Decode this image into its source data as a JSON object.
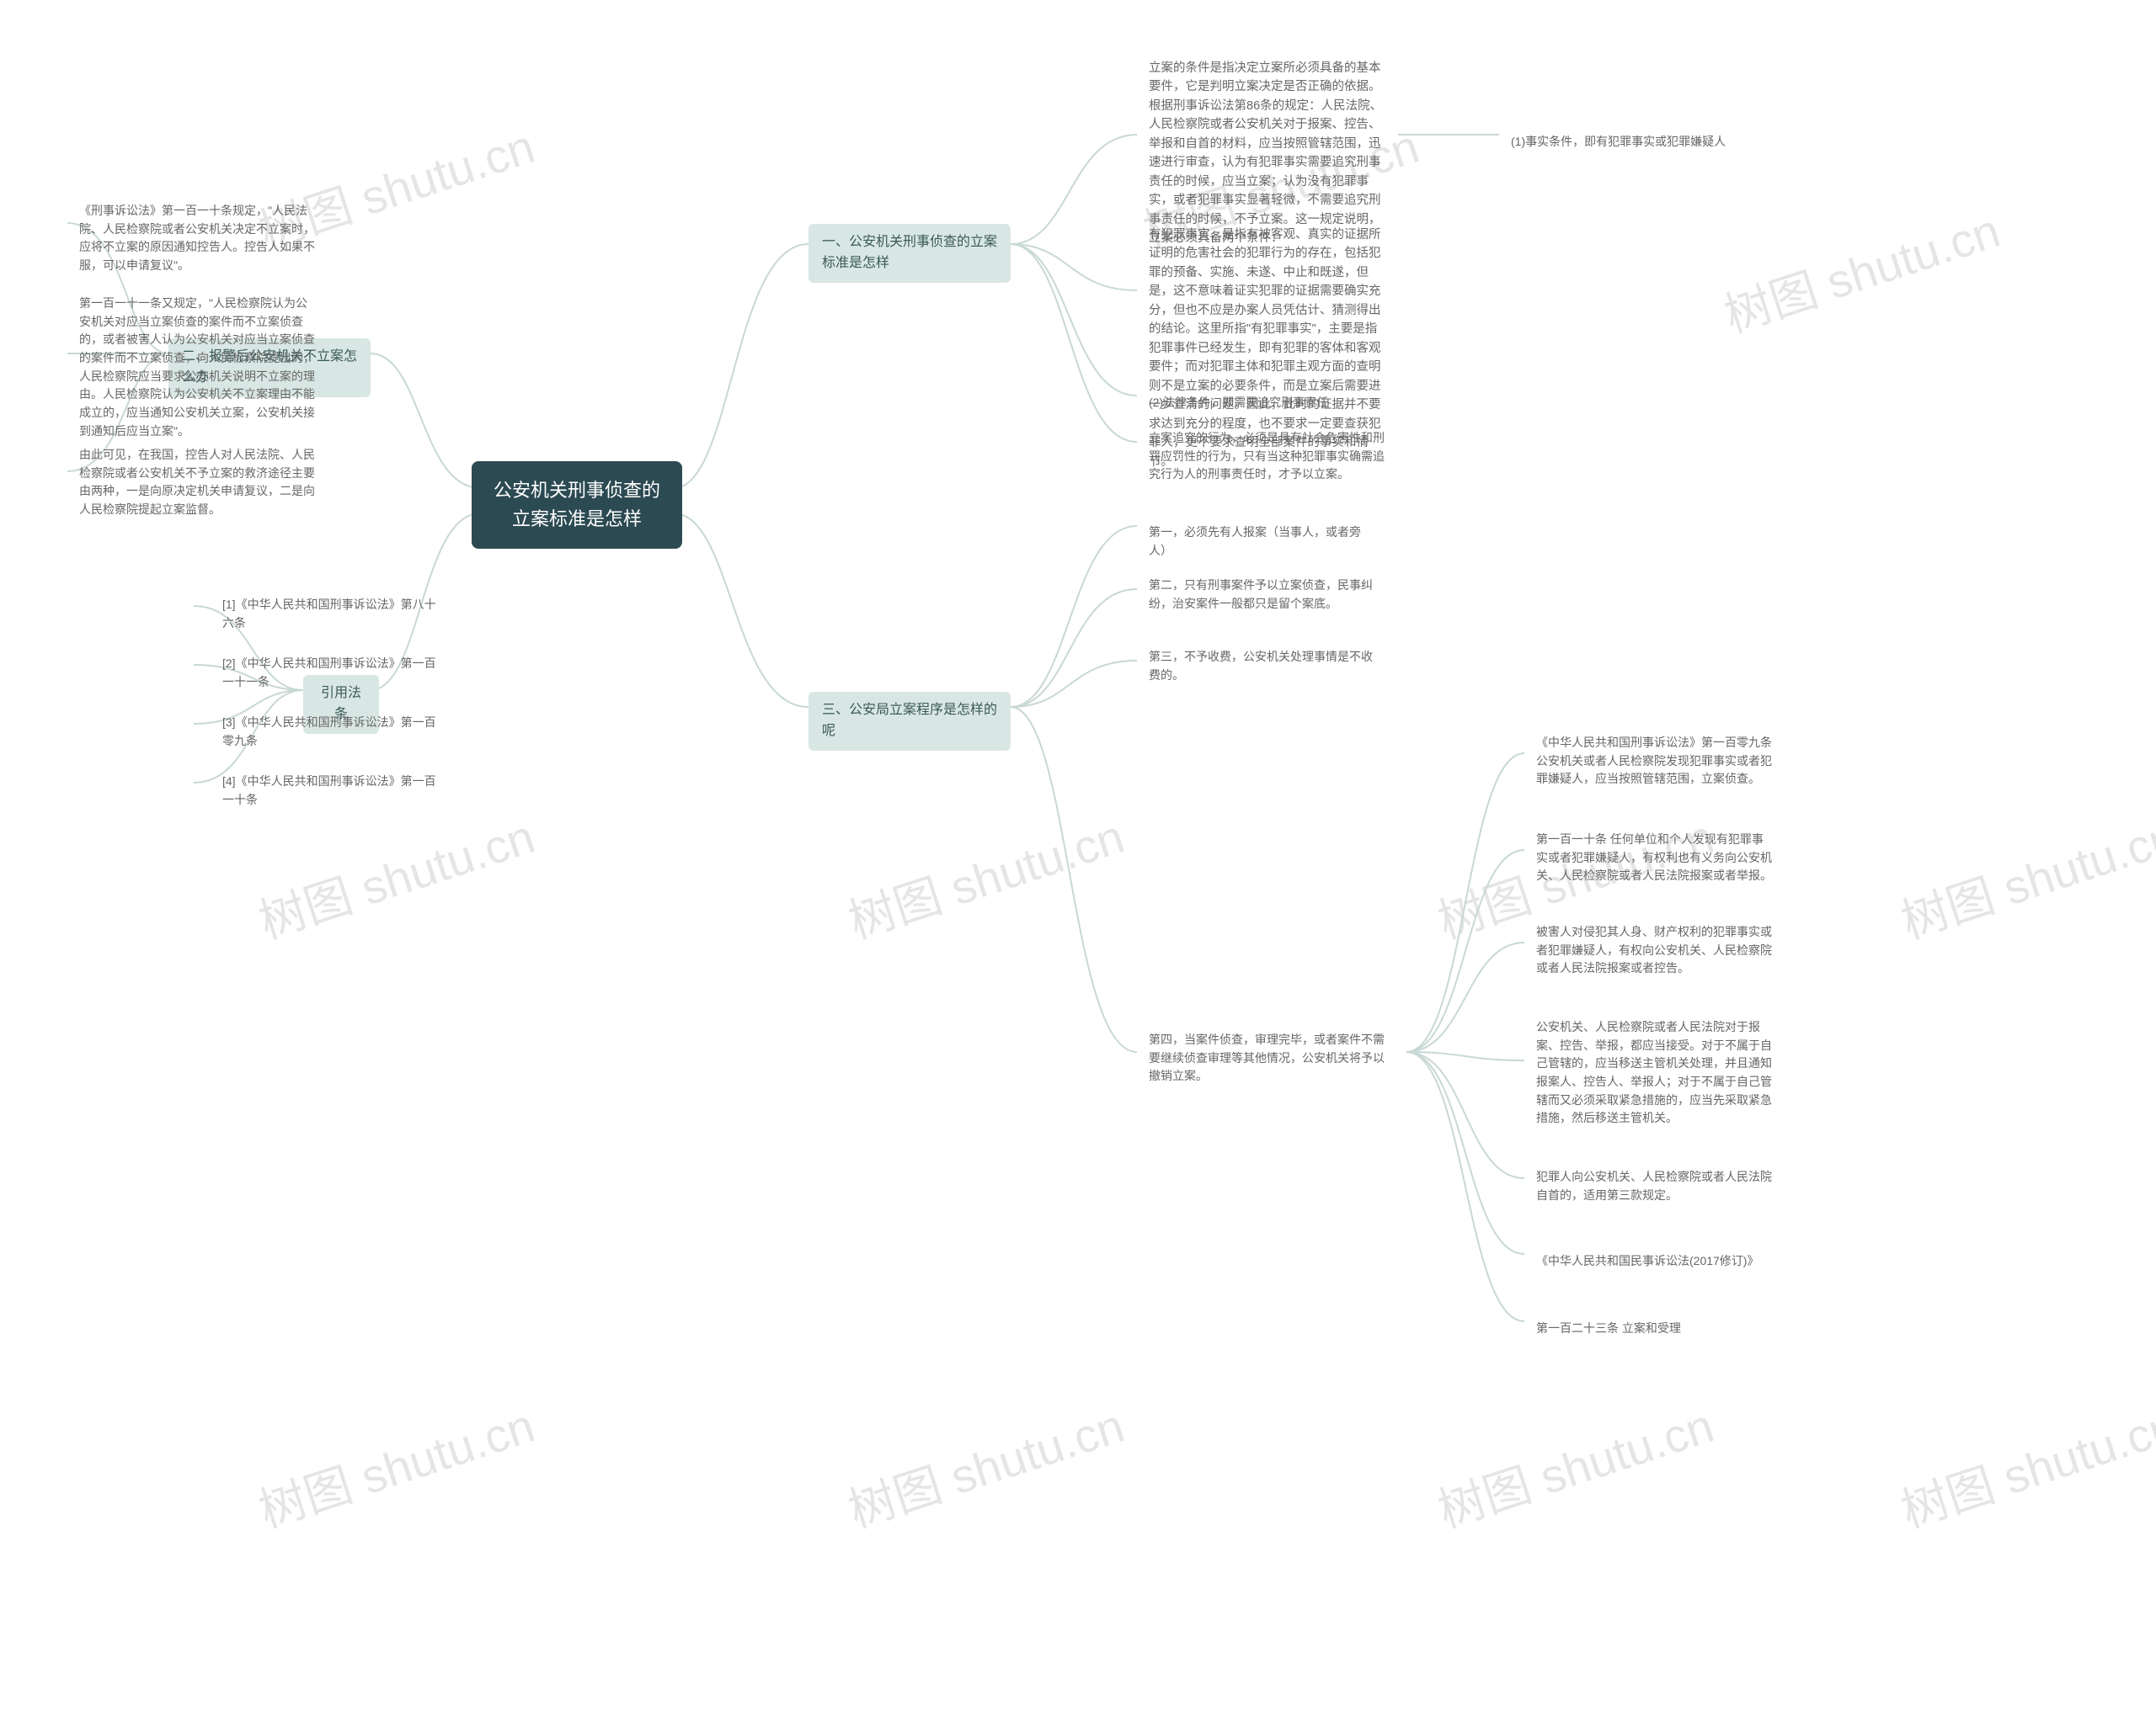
{
  "root": "公安机关刑事侦查的立案标准是怎样",
  "branch1": {
    "title": "一、公安机关刑事侦查的立案标准是怎样",
    "n1": "立案的条件是指决定立案所必须具备的基本要件，它是判明立案决定是否正确的依据。根据刑事诉讼法第86条的规定：人民法院、人民检察院或者公安机关对于报案、控告、举报和自首的材料，应当按照管辖范围，迅速进行审查，认为有犯罪事实需要追究刑事责任的时候，应当立案；认为没有犯罪事实，或者犯罪事实显著轻微，不需要追究刑事责任的时候，不予立案。这一规定说明，立案必须具备两个条件：",
    "n1a": "(1)事实条件，即有犯罪事实或犯罪嫌疑人",
    "n2": "有犯罪事实，是指有被客观、真实的证据所证明的危害社会的犯罪行为的存在，包括犯罪的预备、实施、未遂、中止和既遂，但是，这不意味着证实犯罪的证据需要确实充分，但也不应是办案人员凭估计、猜测得出的结论。这里所指\"有犯罪事实\"，主要是指犯罪事件已经发生，即有犯罪的客体和客观要件；而对犯罪主体和犯罪主观方面的查明则不是立案的必要条件，而是立案后需要进一步查清的问题。因此，此时的证据并不要求达到充分的程度，也不要求一定要查获犯罪人，更不要求查明全部案件的事实和情节。",
    "n3": "(2)法律条件，即需要追究刑事责任",
    "n4": "立案追究的行为，必须是具有社会危害性和刑罚应罚性的行为，只有当这种犯罪事实确需追究行为人的刑事责任时，才予以立案。"
  },
  "branch2": {
    "title": "二、报警后公安机关不立案怎么办",
    "n1": "《刑事诉讼法》第一百一十条规定，\"人民法院、人民检察院或者公安机关决定不立案时，应将不立案的原因通知控告人。控告人如果不服，可以申请复议\"。",
    "n2": "第一百一十一条又规定，\"人民检察院认为公安机关对应当立案侦查的案件而不立案侦查的，或者被害人认为公安机关对应当立案侦查的案件而不立案侦查，向人民检察院提出的，人民检察院应当要求公安机关说明不立案的理由。人民检察院认为公安机关不立案理由不能成立的，应当通知公安机关立案，公安机关接到通知后应当立案\"。",
    "n3": "由此可见，在我国，控告人对人民法院、人民检察院或者公安机关不予立案的救济途径主要由两种，一是向原决定机关申请复议，二是向人民检察院提起立案监督。"
  },
  "branch3": {
    "title": "三、公安局立案程序是怎样的呢",
    "n1": "第一，必须先有人报案（当事人，或者旁人）",
    "n2": "第二，只有刑事案件予以立案侦查，民事纠纷，治安案件一般都只是留个案底。",
    "n3": "第三，不予收费，公安机关处理事情是不收费的。",
    "n4": "第四，当案件侦查，审理完毕，或者案件不需要继续侦查审理等其他情况，公安机关将予以撤销立案。",
    "n4_1": "《中华人民共和国刑事诉讼法》第一百零九条 公安机关或者人民检察院发现犯罪事实或者犯罪嫌疑人，应当按照管辖范围，立案侦查。",
    "n4_2": "第一百一十条 任何单位和个人发现有犯罪事实或者犯罪嫌疑人，有权利也有义务向公安机关、人民检察院或者人民法院报案或者举报。",
    "n4_3": "被害人对侵犯其人身、财产权利的犯罪事实或者犯罪嫌疑人，有权向公安机关、人民检察院或者人民法院报案或者控告。",
    "n4_4": "公安机关、人民检察院或者人民法院对于报案、控告、举报，都应当接受。对于不属于自己管辖的，应当移送主管机关处理，并且通知报案人、控告人、举报人；对于不属于自己管辖而又必须采取紧急措施的，应当先采取紧急措施，然后移送主管机关。",
    "n4_5": "犯罪人向公安机关、人民检察院或者人民法院自首的，适用第三款规定。",
    "n4_6": "《中华人民共和国民事诉讼法(2017修订)》",
    "n4_7": "第一百二十三条 立案和受理"
  },
  "refs": {
    "title": "引用法条",
    "r1": "[1]《中华人民共和国刑事诉讼法》第八十六条",
    "r2": "[2]《中华人民共和国刑事诉讼法》第一百一十一条",
    "r3": "[3]《中华人民共和国刑事诉讼法》第一百零九条",
    "r4": "[4]《中华人民共和国刑事诉讼法》第一百一十条"
  },
  "watermark": "树图 shutu.cn"
}
